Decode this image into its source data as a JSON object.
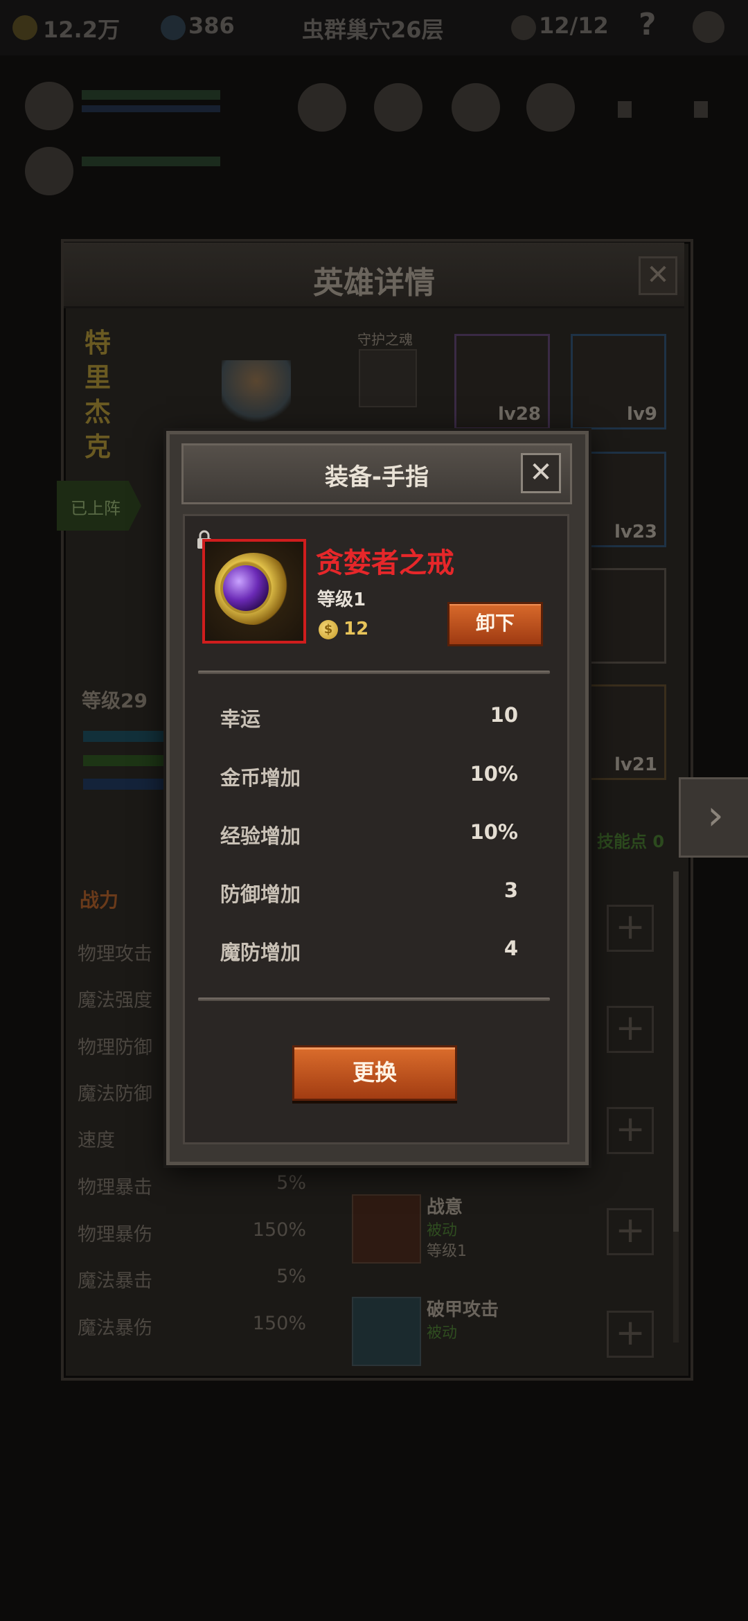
{
  "topbar": {
    "gold": "12.2万",
    "gems": "386",
    "location": "虫群巢穴26层",
    "skulls": "12/12",
    "help": "?"
  },
  "hero_panel": {
    "title": "英雄详情",
    "close": "✕",
    "hero_name_chars": [
      "特",
      "里",
      "杰",
      "克"
    ],
    "guardian_label": "守护之魂",
    "deployed_label": "已上阵",
    "level_label": "等级29",
    "skill_points_label": "技能点 0",
    "power_label": "战力",
    "equipment_slots": [
      {
        "lv": "lv28"
      },
      {
        "lv": "lv9"
      },
      {
        "lv": "lv23"
      },
      {
        "lv": "lv21"
      }
    ],
    "stats": [
      {
        "name": "物理攻击",
        "value": ""
      },
      {
        "name": "魔法强度",
        "value": ""
      },
      {
        "name": "物理防御",
        "value": ""
      },
      {
        "name": "魔法防御",
        "value": ""
      },
      {
        "name": "速度",
        "value": ""
      },
      {
        "name": "物理暴击",
        "value": "5%"
      },
      {
        "name": "物理暴伤",
        "value": "150%"
      },
      {
        "name": "魔法暴击",
        "value": "5%"
      },
      {
        "name": "魔法暴伤",
        "value": "150%"
      }
    ],
    "skills": [
      {
        "name": "战意",
        "type": "被动",
        "level": "等级1"
      },
      {
        "name": "破甲攻击",
        "type": "被动",
        "level": ""
      }
    ],
    "next_arrow": "›"
  },
  "modal": {
    "title": "装备-手指",
    "close": "✕",
    "item_name": "贪婪者之戒",
    "item_level": "等级1",
    "price": "12",
    "coin_symbol": "$",
    "unequip_button": "卸下",
    "attributes": [
      {
        "name": "幸运",
        "value": "10"
      },
      {
        "name": "金币增加",
        "value": "10%"
      },
      {
        "name": "经验增加",
        "value": "10%"
      },
      {
        "name": "防御增加",
        "value": "3"
      },
      {
        "name": "魔防增加",
        "value": "4"
      }
    ],
    "swap_button": "更换"
  },
  "colors": {
    "item_name": "#e6272a",
    "button_orange": "#d86a2b",
    "rarity_frame": "#d01d1d"
  }
}
